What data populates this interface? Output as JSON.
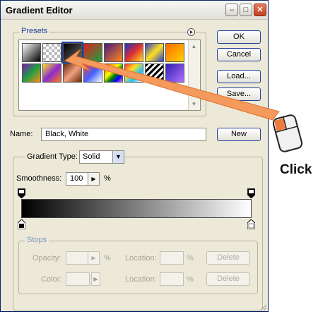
{
  "window": {
    "title": "Gradient Editor",
    "minimize": "–",
    "maximize": "□",
    "close": "✕"
  },
  "presets": {
    "label": "Presets",
    "menu_icon": "circle-arrow-icon",
    "swatches": [
      {
        "name": "black-white",
        "bg": "linear-gradient(135deg,#ffffff,#000000)"
      },
      {
        "name": "transparent-checker",
        "bg": "repeating-conic-gradient(#bbb 0 25%, #fff 0 50%) 0 0/8px 8px"
      },
      {
        "name": "black-transparent",
        "bg": "linear-gradient(135deg,#000000,#6a6a6a)"
      },
      {
        "name": "red-green",
        "bg": "linear-gradient(135deg,#e02020,#20a040)"
      },
      {
        "name": "violet-orange",
        "bg": "linear-gradient(135deg,#4b1a7a,#ff8a1a)"
      },
      {
        "name": "blue-red-yellow",
        "bg": "linear-gradient(135deg,#2030c0,#e03030,#ffe020)"
      },
      {
        "name": "blue-yellow-blue",
        "bg": "linear-gradient(135deg,#2a3cd0,#ffe020,#2a3cd0)"
      },
      {
        "name": "orange-yellow",
        "bg": "linear-gradient(135deg,#ff6a00,#ffd400)"
      },
      {
        "name": "violet-green-orange",
        "bg": "linear-gradient(135deg,#7a1ab0,#20a040,#ff8a1a)"
      },
      {
        "name": "yellow-violet-orange",
        "bg": "linear-gradient(135deg,#ffe020,#8a2ad0,#ff7a1a)"
      },
      {
        "name": "copper",
        "bg": "linear-gradient(135deg,#6a2a10,#f0a080,#6a2a10)"
      },
      {
        "name": "chrome",
        "bg": "linear-gradient(135deg,#ff4040,#4060ff,#ffffff)"
      },
      {
        "name": "spectrum",
        "bg": "linear-gradient(135deg,red,orange,yellow,green,blue,violet)"
      },
      {
        "name": "rainbow-transparent",
        "bg": "linear-gradient(135deg,#ff3030,#ffe020,#20c0ff,#ffffff)"
      },
      {
        "name": "stripes",
        "bg": "repeating-linear-gradient(135deg,#000 0 3px,#fff 3px 6px)"
      },
      {
        "name": "blue-violet",
        "bg": "linear-gradient(135deg,#3020b0,#b070ff)"
      }
    ]
  },
  "buttons": {
    "ok": "OK",
    "cancel": "Cancel",
    "load": "Load...",
    "save": "Save...",
    "new": "New"
  },
  "name_row": {
    "label": "Name:",
    "value": "Black, White"
  },
  "gradient_type": {
    "label": "Gradient Type:",
    "value": "Solid"
  },
  "smoothness": {
    "label": "Smoothness:",
    "value": "100",
    "unit": "%"
  },
  "stops": {
    "label": "Stops",
    "opacity_label": "Opacity:",
    "opacity_unit": "%",
    "location_label": "Location:",
    "location_unit": "%",
    "color_label": "Color:",
    "delete": "Delete"
  },
  "annotation": {
    "text": "Click",
    "arrow_color": "#f0803a",
    "mouse_icon": "mouse-left-click-icon"
  }
}
